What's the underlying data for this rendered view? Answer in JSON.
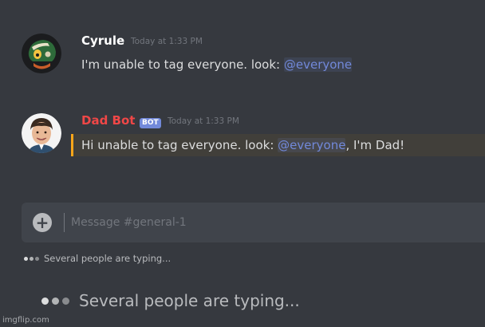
{
  "messages": [
    {
      "username": "Cyrule",
      "timestamp": "Today at 1:33 PM",
      "text_before": "I'm unable to tag everyone. look: ",
      "mention": "@everyone",
      "text_after": ""
    },
    {
      "username": "Dad Bot",
      "bot_tag": "BOT",
      "timestamp": "Today at 1:33 PM",
      "text_before": "Hi unable to tag everyone. look: ",
      "mention": "@everyone",
      "text_after": ", I'm Dad!"
    }
  ],
  "composer": {
    "placeholder": "Message #general-1"
  },
  "typing_small": "Several people are typing...",
  "typing_large": "Several people are typing...",
  "watermark": "imgflip.com",
  "colors": {
    "background": "#36393f",
    "input_background": "#40444b",
    "mention": "#7289da",
    "dad_bot_name": "#f04747",
    "cyrule_name": "#ffffff",
    "highlight_bar": "#faa61a"
  }
}
